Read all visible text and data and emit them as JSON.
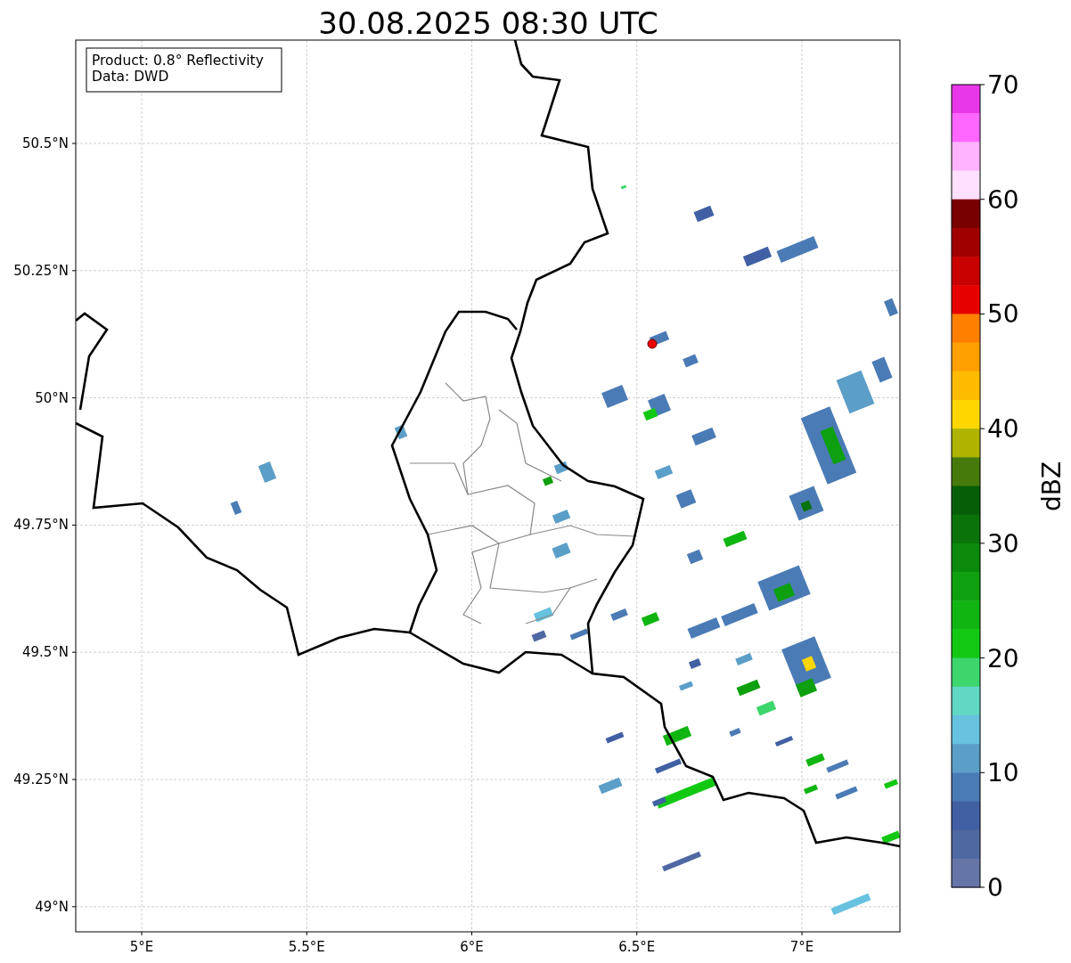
{
  "title": "30.08.2025 08:30 UTC",
  "info_box": [
    "Product: 0.8° Reflectivity",
    "Data: DWD"
  ],
  "x_ticks": [
    "5°E",
    "5.5°E",
    "6°E",
    "6.5°E",
    "7°E"
  ],
  "y_ticks": [
    "50.5°N",
    "50.25°N",
    "50°N",
    "49.75°N",
    "49.5°N",
    "49.25°N",
    "49°N"
  ],
  "colorbar": {
    "label": "dBZ",
    "ticks": [
      "70",
      "60",
      "50",
      "40",
      "30",
      "20",
      "10",
      "0"
    ],
    "bins": [
      {
        "color": "#e837e8"
      },
      {
        "color": "#ff66ff"
      },
      {
        "color": "#ffb3ff"
      },
      {
        "color": "#ffe0ff"
      },
      {
        "color": "#780000"
      },
      {
        "color": "#a00000"
      },
      {
        "color": "#c80000"
      },
      {
        "color": "#e60000"
      },
      {
        "color": "#ff7f00"
      },
      {
        "color": "#ff9f00"
      },
      {
        "color": "#ffbb00"
      },
      {
        "color": "#ffd700"
      },
      {
        "color": "#aeb400"
      },
      {
        "color": "#467a0a"
      },
      {
        "color": "#065f06"
      },
      {
        "color": "#0a730a"
      },
      {
        "color": "#0b8a0b"
      },
      {
        "color": "#0ea00e"
      },
      {
        "color": "#11b511"
      },
      {
        "color": "#13c813"
      },
      {
        "color": "#3cd66c"
      },
      {
        "color": "#60d8c4"
      },
      {
        "color": "#66c2de"
      },
      {
        "color": "#5b9ec8"
      },
      {
        "color": "#4b7bb5"
      },
      {
        "color": "#4160a3"
      },
      {
        "color": "#5068a2"
      },
      {
        "color": "#6675a8"
      }
    ]
  }
}
